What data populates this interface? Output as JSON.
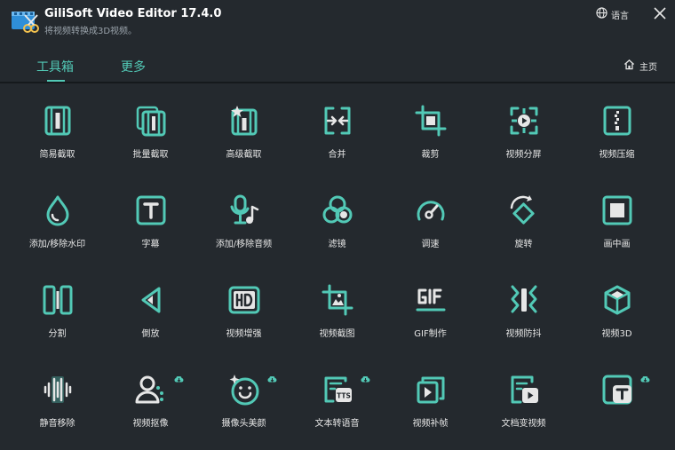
{
  "app": {
    "title": "GiliSoft Video Editor 17.4.0",
    "subtitle": "将视频转换成3D视频。",
    "language_label": "语言"
  },
  "tabs": [
    {
      "label": "工具箱",
      "active": true
    },
    {
      "label": "更多",
      "active": false
    }
  ],
  "home_label": "主页",
  "accent_color": "#52c9b6",
  "tools": [
    {
      "label": "简易截取",
      "icon": "film-cut-icon"
    },
    {
      "label": "批量截取",
      "icon": "batch-film-icon"
    },
    {
      "label": "高级截取",
      "icon": "advanced-film-icon"
    },
    {
      "label": "合并",
      "icon": "merge-icon"
    },
    {
      "label": "裁剪",
      "icon": "crop-icon"
    },
    {
      "label": "视频分屏",
      "icon": "split-screen-icon"
    },
    {
      "label": "视频压缩",
      "icon": "zip-icon"
    },
    {
      "label": "添加/移除水印",
      "icon": "watermark-drop-icon"
    },
    {
      "label": "字幕",
      "icon": "subtitle-t-icon"
    },
    {
      "label": "添加/移除音频",
      "icon": "mic-music-icon"
    },
    {
      "label": "滤镜",
      "icon": "filter-circles-icon"
    },
    {
      "label": "调速",
      "icon": "speedometer-icon"
    },
    {
      "label": "旋转",
      "icon": "rotate-icon"
    },
    {
      "label": "画中画",
      "icon": "picture-in-picture-icon"
    },
    {
      "label": "分割",
      "icon": "split-bars-icon"
    },
    {
      "label": "倒放",
      "icon": "reverse-play-icon"
    },
    {
      "label": "视频增强",
      "icon": "hd-icon"
    },
    {
      "label": "视频截图",
      "icon": "screenshot-image-icon"
    },
    {
      "label": "GIF制作",
      "icon": "gif-icon"
    },
    {
      "label": "视频防抖",
      "icon": "stabilize-icon"
    },
    {
      "label": "视频3D",
      "icon": "cube-3d-icon"
    },
    {
      "label": "静音移除",
      "icon": "waveform-icon"
    },
    {
      "label": "视频抠像",
      "icon": "portrait-matting-icon",
      "download": true
    },
    {
      "label": "摄像头美颜",
      "icon": "face-beauty-icon",
      "download": true
    },
    {
      "label": "文本转语音",
      "icon": "text-to-speech-icon",
      "download": true
    },
    {
      "label": "视频补帧",
      "icon": "frame-interpolation-icon"
    },
    {
      "label": "文档变视频",
      "icon": "document-to-video-icon"
    },
    {
      "label": "",
      "icon": "text-badge-icon",
      "download": true
    }
  ],
  "icons": {
    "language": "globe-icon",
    "close": "close-icon",
    "home": "home-icon",
    "download": "download-cloud-icon"
  }
}
